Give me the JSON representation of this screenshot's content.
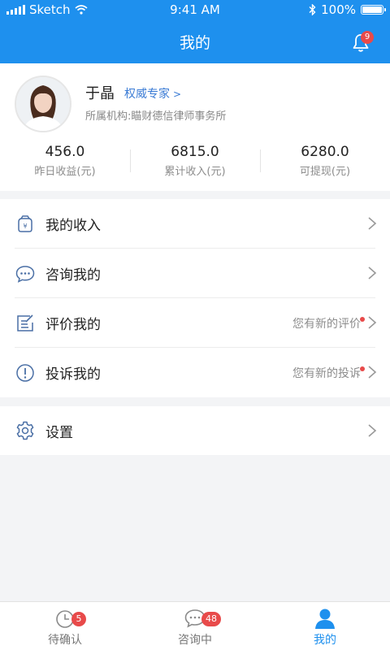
{
  "status": {
    "carrier": "Sketch",
    "time": "9:41 AM",
    "battery": "100%"
  },
  "nav": {
    "title": "我的",
    "bell_badge": "9"
  },
  "profile": {
    "name": "于晶",
    "role": "权威专家",
    "org": "所属机构:瞄财德信律师事务所",
    "stats": [
      {
        "value": "456.0",
        "label": "昨日收益(元)"
      },
      {
        "value": "6815.0",
        "label": "累计收入(元)"
      },
      {
        "value": "6280.0",
        "label": "可提现(元)"
      }
    ]
  },
  "menu": [
    {
      "label": "我的收入",
      "icon": "income-icon",
      "hint": ""
    },
    {
      "label": "咨询我的",
      "icon": "chat-icon",
      "hint": ""
    },
    {
      "label": "评价我的",
      "icon": "review-icon",
      "hint": "您有新的评价"
    },
    {
      "label": "投诉我的",
      "icon": "alert-icon",
      "hint": "您有新的投诉"
    }
  ],
  "settings": {
    "label": "设置",
    "icon": "gear-icon"
  },
  "tabs": [
    {
      "label": "待确认",
      "badge": "5",
      "icon": "clock-icon"
    },
    {
      "label": "咨询中",
      "badge": "48",
      "icon": "chat-bubble-icon"
    },
    {
      "label": "我的",
      "badge": "",
      "icon": "user-icon",
      "active": true
    }
  ],
  "colors": {
    "primary": "#1e90ee",
    "badge": "#e84a4a",
    "link": "#3a7bd5"
  }
}
